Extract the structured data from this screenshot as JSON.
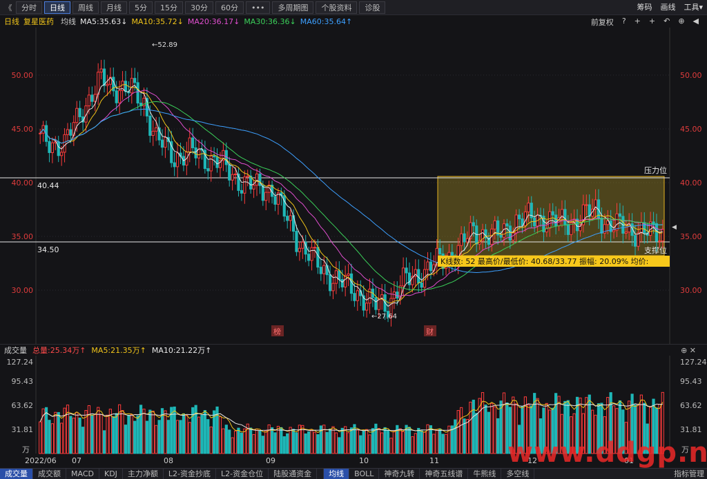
{
  "toolbar": {
    "back": "《",
    "periods": [
      "分时",
      "日线",
      "周线",
      "月线",
      "5分",
      "15分",
      "30分",
      "60分",
      "•••",
      "多周期图",
      "个股资料",
      "诊股"
    ],
    "active_index": 1,
    "right": [
      "筹码",
      "画线",
      "工具",
      "▾"
    ]
  },
  "infobar": {
    "period": "日线",
    "name": "复星医药",
    "avg": "均线",
    "ma": [
      {
        "label": "MA5:35.63↓",
        "color": "#e8e8e8"
      },
      {
        "label": "MA10:35.72↓",
        "color": "#f0c419"
      },
      {
        "label": "MA20:36.17↓",
        "color": "#e14fd0"
      },
      {
        "label": "MA30:36.36↓",
        "color": "#3bd15a"
      },
      {
        "label": "MA60:35.64↑",
        "color": "#3da0ff"
      }
    ],
    "adjust": "前复权",
    "icons": [
      "?",
      "+",
      "+",
      "↶",
      "⊕",
      "◀"
    ]
  },
  "price_axis": {
    "ticks": [
      "50.00",
      "45.00",
      "40.00",
      "35.00",
      "30.00"
    ]
  },
  "annotations": {
    "high": "52.89",
    "low": "27.64",
    "resistance_value": "40.44",
    "support_value": "34.50",
    "resistance_label": "压力位",
    "support_label": "支撑位",
    "range_info": "K线数: 52 最高价/最低价: 40.68/33.77 振幅: 20.09% 均价:",
    "event_markers": [
      "榜",
      "财"
    ]
  },
  "volume": {
    "title": "成交量",
    "total": "总量:25.34万↑",
    "ma5": "MA5:21.35万↑",
    "ma10": "MA10:21.22万↑",
    "ticks": [
      "127.24",
      "95.43",
      "63.62",
      "31.81"
    ],
    "unit": "万"
  },
  "x_axis": {
    "labels": [
      "2022/06",
      "07",
      "08",
      "09",
      "10",
      "11",
      "12",
      "01"
    ]
  },
  "bottom_tabs": {
    "items": [
      "成交量",
      "成交额",
      "MACD",
      "KDJ",
      "主力净额",
      "L2-资金抄底",
      "L2-资金仓位",
      "陆股通资金",
      "均线",
      "BOLL",
      "神奇九转",
      "神奇五线谱",
      "牛熊线",
      "多空线"
    ],
    "active": [
      0,
      8
    ],
    "right": "指标管理"
  },
  "watermark": "www.ddgp.net",
  "colors": {
    "up": "#ff3b3b",
    "down": "#1fb7b7",
    "ma5": "#e8e8e8",
    "ma10": "#f0c419",
    "ma20": "#e14fd0",
    "ma30": "#3bd15a",
    "ma60": "#3da0ff",
    "box": "#e6b422"
  }
}
